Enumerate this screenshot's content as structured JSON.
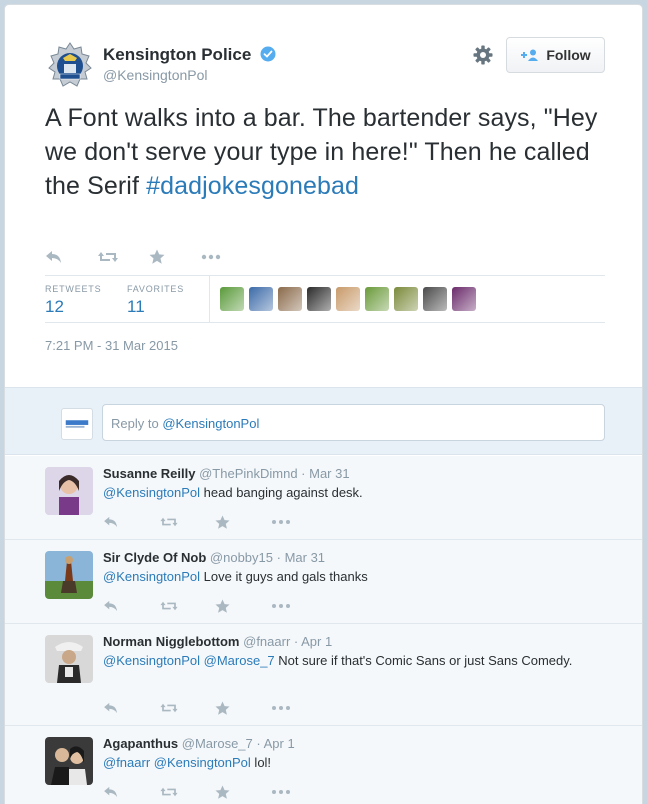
{
  "tweet": {
    "display_name": "Kensington Police",
    "screen_name": "@KensingtonPol",
    "follow_label": "Follow",
    "text_main": "A Font walks into a bar. The bartender says, \"Hey we don't serve your type in here!\" Then he called the Serif ",
    "hashtag": "#dadjokesgonebad",
    "retweets_label": "RETWEETS",
    "retweets_count": "12",
    "favorites_label": "FAVORITES",
    "favorites_count": "11",
    "timestamp": "7:21 PM - 31 Mar 2015",
    "favoriter_colors": [
      "#5a9a3a",
      "#3b6aa8",
      "#8a6a4a",
      "#2a2a2a",
      "#c89a6a",
      "#6a9a3a",
      "#7a8a3a",
      "#4a4a4a",
      "#6a2a6a"
    ]
  },
  "reply_box": {
    "prefix": "Reply to ",
    "mention": "@KensingtonPol"
  },
  "replies": [
    {
      "name": "Susanne Reilly",
      "handle": "@ThePinkDimnd",
      "time": "Mar 31",
      "mentions": "@KensingtonPol",
      "text": " head banging against desk."
    },
    {
      "name": "Sir Clyde Of Nob",
      "handle": "@nobby15",
      "time": "Mar 31",
      "mentions": "@KensingtonPol",
      "text": " Love it guys and gals thanks"
    },
    {
      "name": "Norman Nigglebottom",
      "handle": "@fnaarr",
      "time": "Apr 1",
      "mentions": "@KensingtonPol @Marose_7",
      "text": " Not sure if that's Comic Sans or just Sans Comedy."
    },
    {
      "name": "Agapanthus",
      "handle": "@Marose_7",
      "time": "Apr 1",
      "mentions": "@fnaarr @KensingtonPol",
      "text": " lol!"
    }
  ],
  "separator": " · "
}
